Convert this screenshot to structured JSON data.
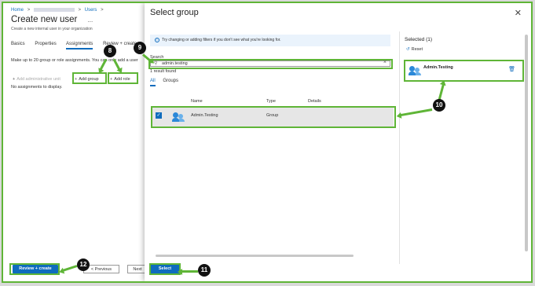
{
  "breadcrumb": {
    "home": "Home",
    "sep": ">",
    "users": "Users"
  },
  "page": {
    "title": "Create new user",
    "more": "...",
    "subtitle": "Create a new internal user in your organization",
    "tabs": [
      "Basics",
      "Properties",
      "Assignments",
      "Review + create"
    ],
    "info_text": "Make up to 20 group or role assignments. You can only add a user",
    "add_admin_unit": "Add administrative unit",
    "add_group": "Add group",
    "add_role": "Add role",
    "no_assignments": "No assignments to display.",
    "review_create": "Review + create",
    "previous": "< Previous",
    "next": "Next"
  },
  "dialog": {
    "title": "Select group",
    "close": "✕",
    "banner": "Try changing or adding filters if you don't see what you're looking for.",
    "search_label": "Search",
    "search_value": "admin.testing",
    "result_count": "1 result found",
    "tabs": [
      "All",
      "Groups"
    ],
    "columns": {
      "name": "Name",
      "type": "Type",
      "details": "Details"
    },
    "row": {
      "name": "Admin.Testing",
      "type": "Group"
    },
    "selected_header": "Selected (1)",
    "reset": "Reset",
    "selected_item": "Admin.Testing",
    "select_button": "Select"
  },
  "callouts": {
    "c8": "8",
    "c9": "9",
    "c10": "10",
    "c11": "11",
    "c12": "12"
  },
  "colors": {
    "accent": "#0f6cbd",
    "highlight": "#5fb537"
  }
}
